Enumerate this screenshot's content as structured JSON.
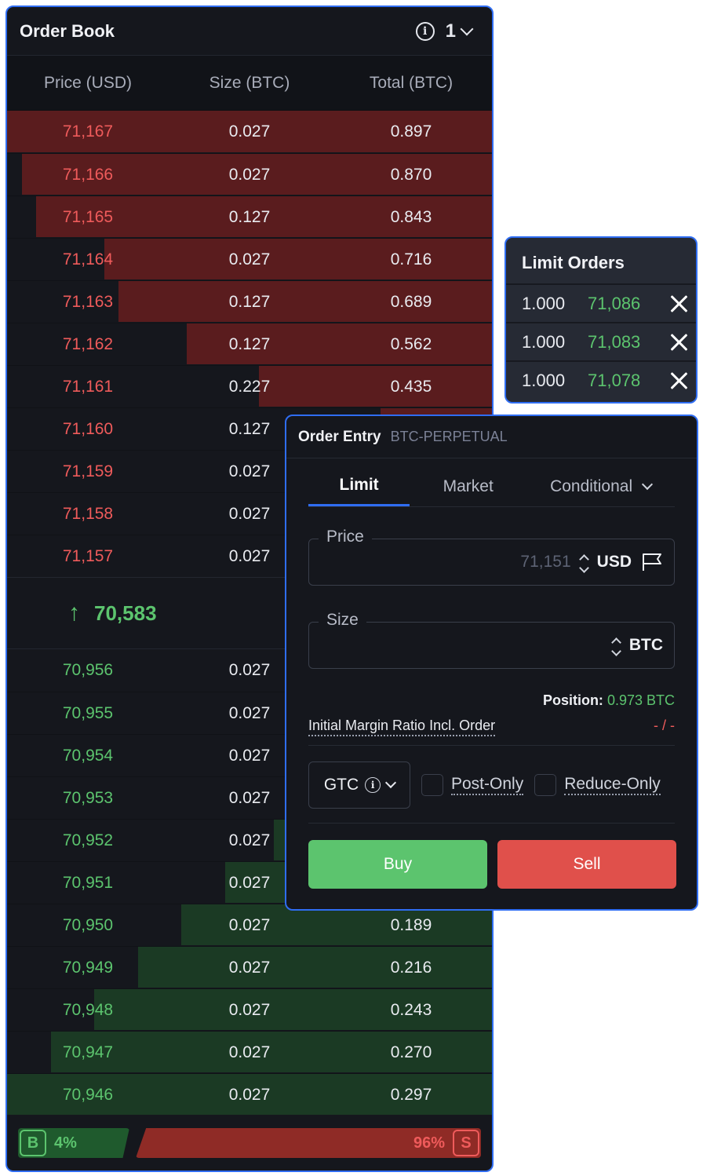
{
  "order_book": {
    "title": "Order Book",
    "info_icon": "i",
    "grouping": "1",
    "columns": [
      "Price (USD)",
      "Size (BTC)",
      "Total (BTC)"
    ],
    "asks": [
      {
        "price": "71,167",
        "size": "0.027",
        "total": "0.897",
        "depth": 1.0
      },
      {
        "price": "71,166",
        "size": "0.027",
        "total": "0.870",
        "depth": 0.97
      },
      {
        "price": "71,165",
        "size": "0.127",
        "total": "0.843",
        "depth": 0.94
      },
      {
        "price": "71,164",
        "size": "0.027",
        "total": "0.716",
        "depth": 0.8
      },
      {
        "price": "71,163",
        "size": "0.127",
        "total": "0.689",
        "depth": 0.77
      },
      {
        "price": "71,162",
        "size": "0.127",
        "total": "0.562",
        "depth": 0.63
      },
      {
        "price": "71,161",
        "size": "0.227",
        "total": "0.435",
        "depth": 0.48
      },
      {
        "price": "71,160",
        "size": "0.127",
        "total": "",
        "depth": 0.23
      },
      {
        "price": "71,159",
        "size": "0.027",
        "total": "",
        "depth": 0
      },
      {
        "price": "71,158",
        "size": "0.027",
        "total": "",
        "depth": 0
      },
      {
        "price": "71,157",
        "size": "0.027",
        "total": "",
        "depth": 0
      }
    ],
    "mid_price": "70,583",
    "bids": [
      {
        "price": "70,956",
        "size": "0.027",
        "total": "",
        "depth": 0
      },
      {
        "price": "70,955",
        "size": "0.027",
        "total": "",
        "depth": 0
      },
      {
        "price": "70,954",
        "size": "0.027",
        "total": "",
        "depth": 0
      },
      {
        "price": "70,953",
        "size": "0.027",
        "total": "",
        "depth": 0
      },
      {
        "price": "70,952",
        "size": "0.027",
        "total": "",
        "depth": 0.45
      },
      {
        "price": "70,951",
        "size": "0.027",
        "total": "",
        "depth": 0.55
      },
      {
        "price": "70,950",
        "size": "0.027",
        "total": "0.189",
        "depth": 0.64
      },
      {
        "price": "70,949",
        "size": "0.027",
        "total": "0.216",
        "depth": 0.73
      },
      {
        "price": "70,948",
        "size": "0.027",
        "total": "0.243",
        "depth": 0.82
      },
      {
        "price": "70,947",
        "size": "0.027",
        "total": "0.270",
        "depth": 0.91
      },
      {
        "price": "70,946",
        "size": "0.027",
        "total": "0.297",
        "depth": 1.0
      }
    ],
    "ratio": {
      "buy_tag": "B",
      "buy_pct": "4%",
      "sell_pct": "96%",
      "sell_tag": "S"
    }
  },
  "limit_orders": {
    "title": "Limit Orders",
    "orders": [
      {
        "size": "1.000",
        "price": "71,086"
      },
      {
        "size": "1.000",
        "price": "71,083"
      },
      {
        "size": "1.000",
        "price": "71,078"
      }
    ]
  },
  "order_entry": {
    "title": "Order Entry",
    "symbol": "BTC-PERPETUAL",
    "tabs": [
      "Limit",
      "Market",
      "Conditional"
    ],
    "price": {
      "label": "Price",
      "value": "71,151",
      "unit": "USD"
    },
    "size": {
      "label": "Size",
      "value": "",
      "unit": "BTC"
    },
    "position_label": "Position:",
    "position_value": "0.973 BTC",
    "imr_label": "Initial Margin Ratio Incl. Order",
    "imr_value": "- / -",
    "time_in_force": "GTC",
    "post_only": "Post-Only",
    "reduce_only": "Reduce-Only",
    "buy_label": "Buy",
    "sell_label": "Sell"
  },
  "colors": {
    "accent": "#2f6df2",
    "buy": "#5cc46e",
    "sell": "#ef5b5b"
  }
}
